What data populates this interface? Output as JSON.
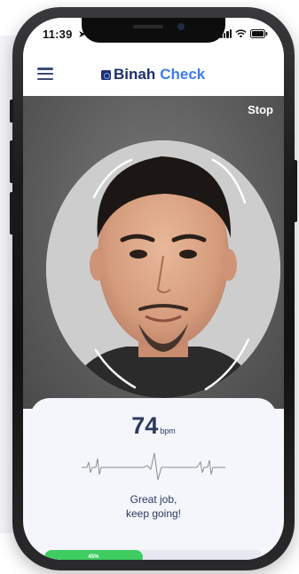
{
  "status_bar": {
    "time": "11:39"
  },
  "header": {
    "brand_primary": "Binah",
    "brand_secondary": "Check"
  },
  "camera": {
    "stop_label": "Stop"
  },
  "measurement": {
    "heart_rate": "74",
    "unit": "bpm",
    "message_line1": "Great job,",
    "message_line2": "keep going!",
    "progress_label": "45%",
    "progress_value": 0.45
  },
  "colors": {
    "brand_dark": "#1d2f6b",
    "brand_accent": "#3c7bf1",
    "progress_green": "#3fcd62",
    "text_dark": "#2c3a5c"
  },
  "icons": {
    "menu": "hamburger-icon",
    "location": "location-arrow-icon",
    "signal": "signal-icon",
    "wifi": "wifi-icon",
    "battery": "battery-icon",
    "ecg": "heartbeat-wave-icon"
  }
}
